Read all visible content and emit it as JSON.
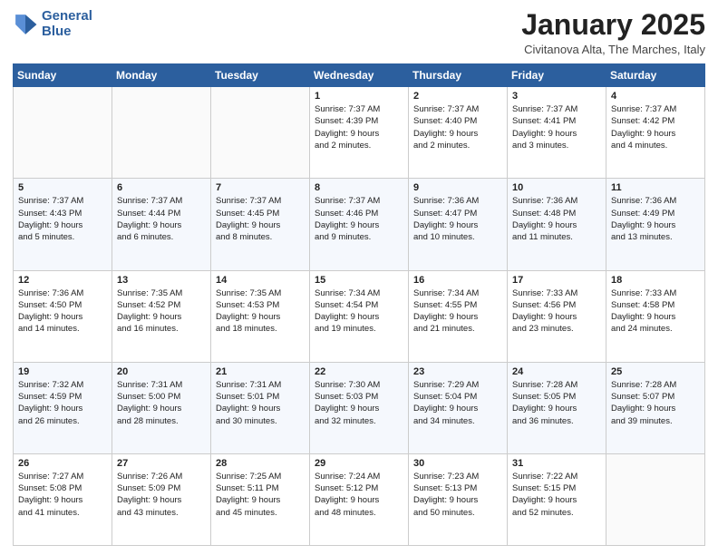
{
  "logo": {
    "line1": "General",
    "line2": "Blue"
  },
  "header": {
    "month": "January 2025",
    "location": "Civitanova Alta, The Marches, Italy"
  },
  "weekdays": [
    "Sunday",
    "Monday",
    "Tuesday",
    "Wednesday",
    "Thursday",
    "Friday",
    "Saturday"
  ],
  "weeks": [
    [
      {
        "day": "",
        "info": ""
      },
      {
        "day": "",
        "info": ""
      },
      {
        "day": "",
        "info": ""
      },
      {
        "day": "1",
        "info": "Sunrise: 7:37 AM\nSunset: 4:39 PM\nDaylight: 9 hours\nand 2 minutes."
      },
      {
        "day": "2",
        "info": "Sunrise: 7:37 AM\nSunset: 4:40 PM\nDaylight: 9 hours\nand 2 minutes."
      },
      {
        "day": "3",
        "info": "Sunrise: 7:37 AM\nSunset: 4:41 PM\nDaylight: 9 hours\nand 3 minutes."
      },
      {
        "day": "4",
        "info": "Sunrise: 7:37 AM\nSunset: 4:42 PM\nDaylight: 9 hours\nand 4 minutes."
      }
    ],
    [
      {
        "day": "5",
        "info": "Sunrise: 7:37 AM\nSunset: 4:43 PM\nDaylight: 9 hours\nand 5 minutes."
      },
      {
        "day": "6",
        "info": "Sunrise: 7:37 AM\nSunset: 4:44 PM\nDaylight: 9 hours\nand 6 minutes."
      },
      {
        "day": "7",
        "info": "Sunrise: 7:37 AM\nSunset: 4:45 PM\nDaylight: 9 hours\nand 8 minutes."
      },
      {
        "day": "8",
        "info": "Sunrise: 7:37 AM\nSunset: 4:46 PM\nDaylight: 9 hours\nand 9 minutes."
      },
      {
        "day": "9",
        "info": "Sunrise: 7:36 AM\nSunset: 4:47 PM\nDaylight: 9 hours\nand 10 minutes."
      },
      {
        "day": "10",
        "info": "Sunrise: 7:36 AM\nSunset: 4:48 PM\nDaylight: 9 hours\nand 11 minutes."
      },
      {
        "day": "11",
        "info": "Sunrise: 7:36 AM\nSunset: 4:49 PM\nDaylight: 9 hours\nand 13 minutes."
      }
    ],
    [
      {
        "day": "12",
        "info": "Sunrise: 7:36 AM\nSunset: 4:50 PM\nDaylight: 9 hours\nand 14 minutes."
      },
      {
        "day": "13",
        "info": "Sunrise: 7:35 AM\nSunset: 4:52 PM\nDaylight: 9 hours\nand 16 minutes."
      },
      {
        "day": "14",
        "info": "Sunrise: 7:35 AM\nSunset: 4:53 PM\nDaylight: 9 hours\nand 18 minutes."
      },
      {
        "day": "15",
        "info": "Sunrise: 7:34 AM\nSunset: 4:54 PM\nDaylight: 9 hours\nand 19 minutes."
      },
      {
        "day": "16",
        "info": "Sunrise: 7:34 AM\nSunset: 4:55 PM\nDaylight: 9 hours\nand 21 minutes."
      },
      {
        "day": "17",
        "info": "Sunrise: 7:33 AM\nSunset: 4:56 PM\nDaylight: 9 hours\nand 23 minutes."
      },
      {
        "day": "18",
        "info": "Sunrise: 7:33 AM\nSunset: 4:58 PM\nDaylight: 9 hours\nand 24 minutes."
      }
    ],
    [
      {
        "day": "19",
        "info": "Sunrise: 7:32 AM\nSunset: 4:59 PM\nDaylight: 9 hours\nand 26 minutes."
      },
      {
        "day": "20",
        "info": "Sunrise: 7:31 AM\nSunset: 5:00 PM\nDaylight: 9 hours\nand 28 minutes."
      },
      {
        "day": "21",
        "info": "Sunrise: 7:31 AM\nSunset: 5:01 PM\nDaylight: 9 hours\nand 30 minutes."
      },
      {
        "day": "22",
        "info": "Sunrise: 7:30 AM\nSunset: 5:03 PM\nDaylight: 9 hours\nand 32 minutes."
      },
      {
        "day": "23",
        "info": "Sunrise: 7:29 AM\nSunset: 5:04 PM\nDaylight: 9 hours\nand 34 minutes."
      },
      {
        "day": "24",
        "info": "Sunrise: 7:28 AM\nSunset: 5:05 PM\nDaylight: 9 hours\nand 36 minutes."
      },
      {
        "day": "25",
        "info": "Sunrise: 7:28 AM\nSunset: 5:07 PM\nDaylight: 9 hours\nand 39 minutes."
      }
    ],
    [
      {
        "day": "26",
        "info": "Sunrise: 7:27 AM\nSunset: 5:08 PM\nDaylight: 9 hours\nand 41 minutes."
      },
      {
        "day": "27",
        "info": "Sunrise: 7:26 AM\nSunset: 5:09 PM\nDaylight: 9 hours\nand 43 minutes."
      },
      {
        "day": "28",
        "info": "Sunrise: 7:25 AM\nSunset: 5:11 PM\nDaylight: 9 hours\nand 45 minutes."
      },
      {
        "day": "29",
        "info": "Sunrise: 7:24 AM\nSunset: 5:12 PM\nDaylight: 9 hours\nand 48 minutes."
      },
      {
        "day": "30",
        "info": "Sunrise: 7:23 AM\nSunset: 5:13 PM\nDaylight: 9 hours\nand 50 minutes."
      },
      {
        "day": "31",
        "info": "Sunrise: 7:22 AM\nSunset: 5:15 PM\nDaylight: 9 hours\nand 52 minutes."
      },
      {
        "day": "",
        "info": ""
      }
    ]
  ]
}
